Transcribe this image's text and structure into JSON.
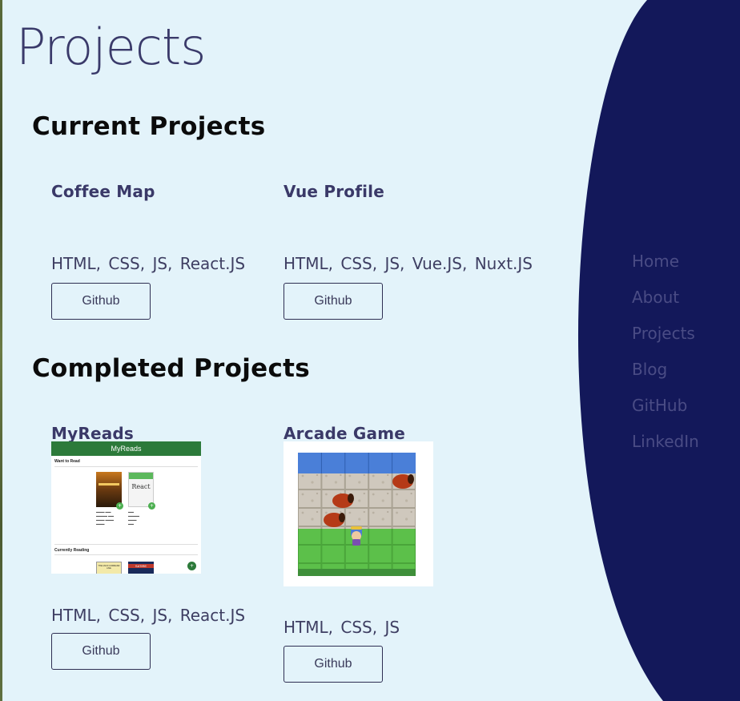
{
  "page": {
    "title": "Projects"
  },
  "sections": {
    "current": {
      "title": "Current Projects",
      "projects": [
        {
          "name": "Coffee Map",
          "tech": "HTML, CSS, JS, React.JS",
          "button": "Github"
        },
        {
          "name": "Vue Profile",
          "tech": "HTML, CSS, JS, Vue.JS, Nuxt.JS",
          "button": "Github"
        }
      ]
    },
    "completed": {
      "title": "Completed Projects",
      "projects": [
        {
          "name": "MyReads",
          "tech": "HTML, CSS, JS, React.JS",
          "button": "Github",
          "thumbnail": {
            "header": "MyReads",
            "shelf_1": "Want to Read",
            "shelf_2": "Currently Reading",
            "book_1_cover_text": "React",
            "book_3_cover_text": "THE LINUX COMMAND LINE",
            "book_4_cover_text": "SATIRE",
            "fab_symbol": "+"
          }
        },
        {
          "name": "Arcade Game",
          "tech": "HTML, CSS, JS",
          "button": "Github"
        }
      ]
    }
  },
  "nav": {
    "items": [
      "Home",
      "About",
      "Projects",
      "Blog",
      "GitHub",
      "LinkedIn"
    ]
  },
  "colors": {
    "background": "#e3f3fa",
    "nav_background": "#13185a",
    "nav_text": "#4a4c85",
    "heading": "#3a3968",
    "myreads_header": "#2c7a3a"
  },
  "icons": {
    "fab": "plus-icon"
  }
}
